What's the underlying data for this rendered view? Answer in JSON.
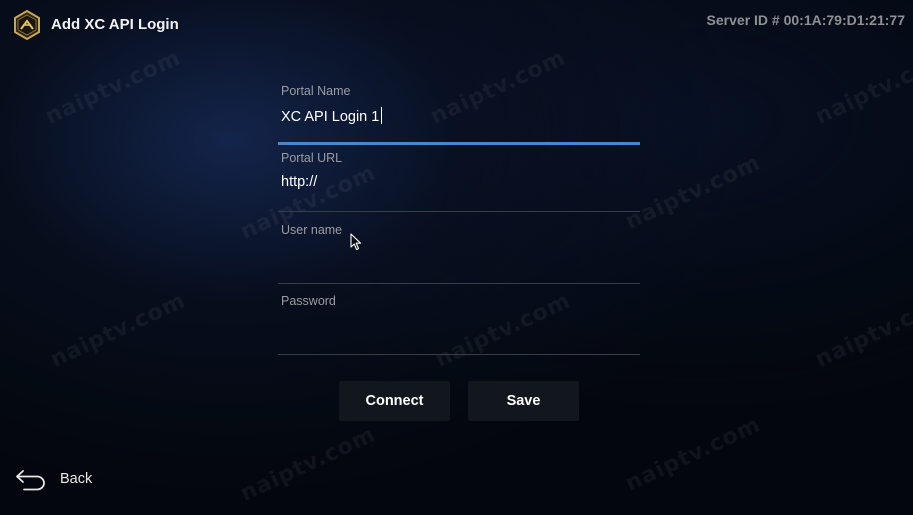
{
  "header": {
    "title": "Add XC API Login",
    "server_id": "Server ID # 00:1A:79:D1:21:77"
  },
  "form": {
    "portal_name": {
      "label": "Portal Name",
      "value": "XC API Login 1"
    },
    "portal_url": {
      "label": "Portal URL",
      "value": "http://"
    },
    "user_name": {
      "label": "User name",
      "value": ""
    },
    "password": {
      "label": "Password",
      "value": ""
    }
  },
  "buttons": {
    "connect": "Connect",
    "save": "Save"
  },
  "footer": {
    "back_label": "Back"
  },
  "watermark_text": "naiptv.com",
  "colors": {
    "accent": "#4a86c8",
    "background": "#03060c",
    "button": "#12161d"
  },
  "icons": {
    "logo": "app-logo-icon",
    "back": "back-arrow-icon",
    "cursor": "mouse-pointer-icon"
  }
}
